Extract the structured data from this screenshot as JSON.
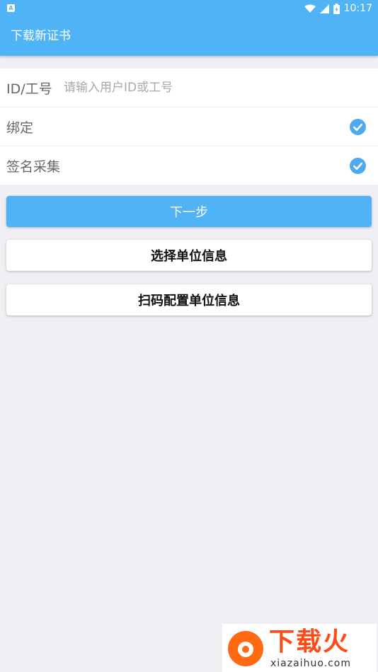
{
  "status_bar": {
    "time": "10:17",
    "icons": [
      "notification-icon",
      "wifi-icon",
      "signal-icon",
      "battery-icon"
    ]
  },
  "app_bar": {
    "title": "下载新证书"
  },
  "form": {
    "id_field": {
      "label": "ID/工号",
      "placeholder": "请输入用户ID或工号",
      "value": ""
    },
    "bind_row": {
      "label": "绑定",
      "checked": true
    },
    "signature_row": {
      "label": "签名采集",
      "checked": true
    }
  },
  "buttons": {
    "next": "下一步",
    "select_unit": "选择单位信息",
    "scan_unit": "扫码配置单位信息"
  },
  "watermark": {
    "brand": "下载火",
    "domain": "xiazaihuo.com"
  },
  "colors": {
    "accent": "#4fb3f5",
    "check": "#4ea9ef",
    "watermark": "#ff4a17"
  }
}
